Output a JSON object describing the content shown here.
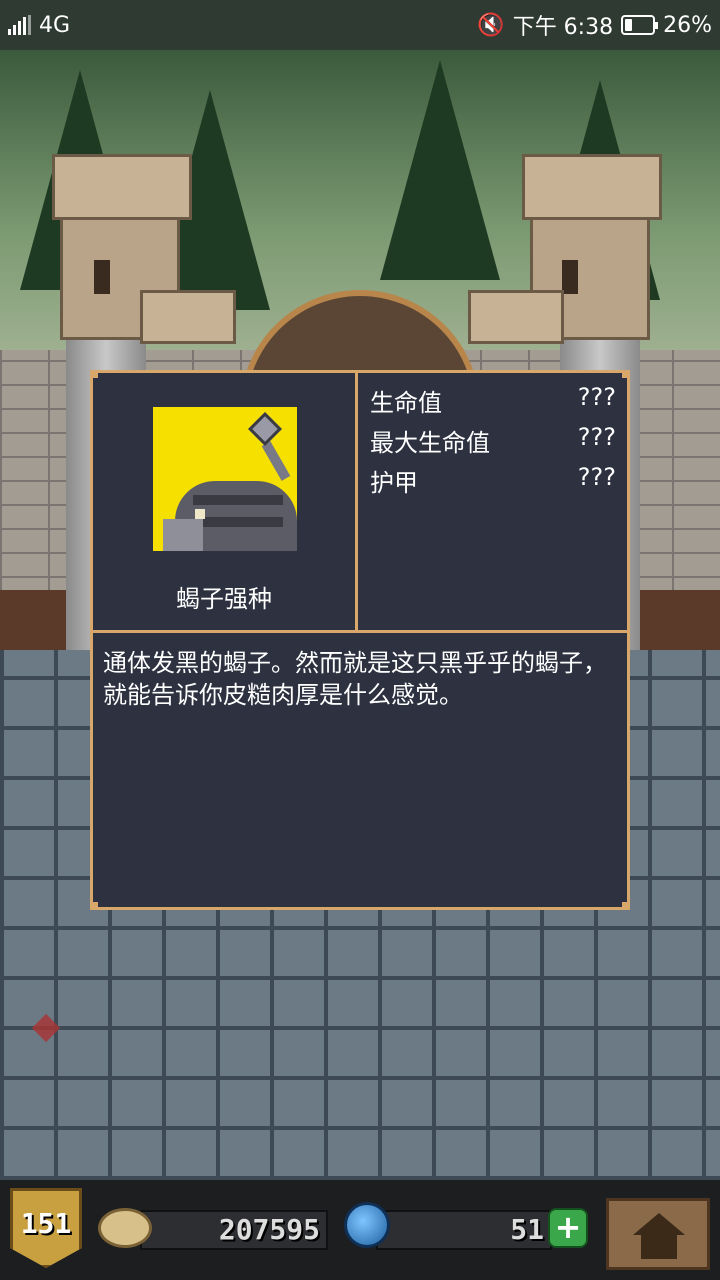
{
  "status_bar": {
    "network": "4G",
    "time": "下午 6:38",
    "battery": "26%",
    "battery_level": 0.26,
    "icons": [
      "signal-icon",
      "mute-icon",
      "battery-icon"
    ]
  },
  "monster": {
    "name": "蝎子强种",
    "portrait_icon": "scorpion-icon",
    "stats": [
      {
        "label": "生命值",
        "value": "???"
      },
      {
        "label": "最大生命值",
        "value": "???"
      },
      {
        "label": "护甲",
        "value": "???"
      }
    ],
    "description": "通体发黑的蝎子。然而就是这只黑乎乎的蝎子，就能告诉你皮糙肉厚是什么感觉。"
  },
  "bottom_bar": {
    "level": "151",
    "coins": "207595",
    "gems": "51",
    "icons": [
      "level-badge-icon",
      "coin-icon",
      "gem-icon",
      "plus-icon",
      "home-icon"
    ]
  },
  "colors": {
    "panel_bg": "#2d3140",
    "panel_border": "#d9a76a",
    "portrait_bg": "#f5e000"
  }
}
